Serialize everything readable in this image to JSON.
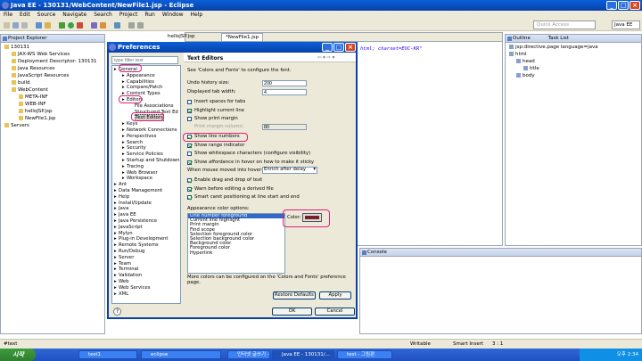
{
  "window": {
    "title": "Java EE - 130131/WebContent/NewFile1.jsp - Eclipse"
  },
  "menu": [
    "File",
    "Edit",
    "Source",
    "Navigate",
    "Search",
    "Project",
    "Run",
    "Window",
    "Help"
  ],
  "toolbar": {
    "quick_access": "Quick Access",
    "perspective": "Java EE"
  },
  "project_explorer": {
    "title": "Project Explorer",
    "items": [
      {
        "label": "130131",
        "indent": 0
      },
      {
        "label": "JAX-WS Web Services",
        "indent": 1
      },
      {
        "label": "Deployment Descriptor: 130131",
        "indent": 1
      },
      {
        "label": "Java Resources",
        "indent": 1
      },
      {
        "label": "JavaScript Resources",
        "indent": 1
      },
      {
        "label": "build",
        "indent": 1
      },
      {
        "label": "WebContent",
        "indent": 1
      },
      {
        "label": "META-INF",
        "indent": 2
      },
      {
        "label": "WEB-INF",
        "indent": 2
      },
      {
        "label": "helloJSP.jsp",
        "indent": 2
      },
      {
        "label": "NewFile1.jsp",
        "indent": 2
      },
      {
        "label": "Servers",
        "indent": 0
      }
    ]
  },
  "editor": {
    "tabs": [
      "helloJSP.jsp",
      "*NewFile1.jsp"
    ],
    "code": "html; charset=EUC-KR\""
  },
  "outline": {
    "title": "Outline",
    "tab2": "Task List",
    "items": [
      {
        "label": "jsp:directive.page language=java",
        "indent": 0
      },
      {
        "label": "html",
        "indent": 0
      },
      {
        "label": "head",
        "indent": 1
      },
      {
        "label": "title",
        "indent": 2
      },
      {
        "label": "body",
        "indent": 1
      }
    ]
  },
  "console": {
    "label": "Console"
  },
  "dialog": {
    "title": "Preferences",
    "filter_placeholder": "type filter text",
    "tree": [
      {
        "label": "General",
        "indent": 0
      },
      {
        "label": "Appearance",
        "indent": 1
      },
      {
        "label": "Capabilities",
        "indent": 1
      },
      {
        "label": "Compare/Patch",
        "indent": 1
      },
      {
        "label": "Content Types",
        "indent": 1
      },
      {
        "label": "Editors",
        "indent": 1
      },
      {
        "label": "File Associations",
        "indent": 2
      },
      {
        "label": "Structured Text Ed",
        "indent": 2
      },
      {
        "label": "Text Editors",
        "indent": 2
      },
      {
        "label": "Keys",
        "indent": 1
      },
      {
        "label": "Network Connections",
        "indent": 1
      },
      {
        "label": "Perspectives",
        "indent": 1
      },
      {
        "label": "Search",
        "indent": 1
      },
      {
        "label": "Security",
        "indent": 1
      },
      {
        "label": "Service Policies",
        "indent": 1
      },
      {
        "label": "Startup and Shutdown",
        "indent": 1
      },
      {
        "label": "Tracing",
        "indent": 1
      },
      {
        "label": "Web Browser",
        "indent": 1
      },
      {
        "label": "Workspace",
        "indent": 1
      },
      {
        "label": "Ant",
        "indent": 0
      },
      {
        "label": "Data Management",
        "indent": 0
      },
      {
        "label": "Help",
        "indent": 0
      },
      {
        "label": "Install/Update",
        "indent": 0
      },
      {
        "label": "Java",
        "indent": 0
      },
      {
        "label": "Java EE",
        "indent": 0
      },
      {
        "label": "Java Persistence",
        "indent": 0
      },
      {
        "label": "JavaScript",
        "indent": 0
      },
      {
        "label": "Mylyn",
        "indent": 0
      },
      {
        "label": "Plug-in Development",
        "indent": 0
      },
      {
        "label": "Remote Systems",
        "indent": 0
      },
      {
        "label": "Run/Debug",
        "indent": 0
      },
      {
        "label": "Server",
        "indent": 0
      },
      {
        "label": "Team",
        "indent": 0
      },
      {
        "label": "Terminal",
        "indent": 0
      },
      {
        "label": "Validation",
        "indent": 0
      },
      {
        "label": "Web",
        "indent": 0
      },
      {
        "label": "Web Services",
        "indent": 0
      },
      {
        "label": "XML",
        "indent": 0
      }
    ],
    "page": {
      "heading": "Text Editors",
      "intro": "See 'Colors and Fonts' to configure the font.",
      "undo_label": "Undo history size:",
      "undo_value": "200",
      "tab_label": "Displayed tab width:",
      "tab_value": "4",
      "checks": [
        {
          "label": "Insert spaces for tabs",
          "checked": false
        },
        {
          "label": "Highlight current line",
          "checked": true
        },
        {
          "label": "Show print margin",
          "checked": false
        }
      ],
      "margin_label": "Print margin column:",
      "margin_value": "80",
      "checks2": [
        {
          "label": "Show line numbers",
          "checked": true
        },
        {
          "label": "Show range indicator",
          "checked": true
        },
        {
          "label": "Show whitespace characters (configure visibility)",
          "checked": false
        },
        {
          "label": "Show affordance in hover on how to make it sticky",
          "checked": true
        }
      ],
      "hover_label": "When mouse moved into hover:",
      "hover_value": "Enrich after delay",
      "checks3": [
        {
          "label": "Enable drag and drop of text",
          "checked": true
        },
        {
          "label": "Warn before editing a derived file",
          "checked": true
        },
        {
          "label": "Smart caret positioning at line start and end",
          "checked": true
        }
      ],
      "color_options_label": "Appearance color options:",
      "color_options": [
        "Line number foreground",
        "Current line highlight",
        "Print margin",
        "Find scope",
        "Selection foreground color",
        "Selection background color",
        "Background color",
        "Foreground color",
        "Hyperlink"
      ],
      "color_label": "Color:",
      "color_value": "#7a1f2e",
      "footer": "More colors can be configured on the 'Colors and Fonts' preference page.",
      "restore": "Restore Defaults",
      "apply": "Apply"
    },
    "ok": "OK",
    "cancel": "Cancel"
  },
  "status": {
    "left": "#text",
    "writable": "Writable",
    "insert": "Smart Insert",
    "pos": "3 : 1"
  },
  "taskbar": {
    "start": "시작",
    "tasks": [
      "test1",
      "eclipse",
      "인터넷 글쓰기 - C...",
      "Java EE - 130131/...",
      "test - 그림판"
    ],
    "clock": "오후 2:34"
  }
}
